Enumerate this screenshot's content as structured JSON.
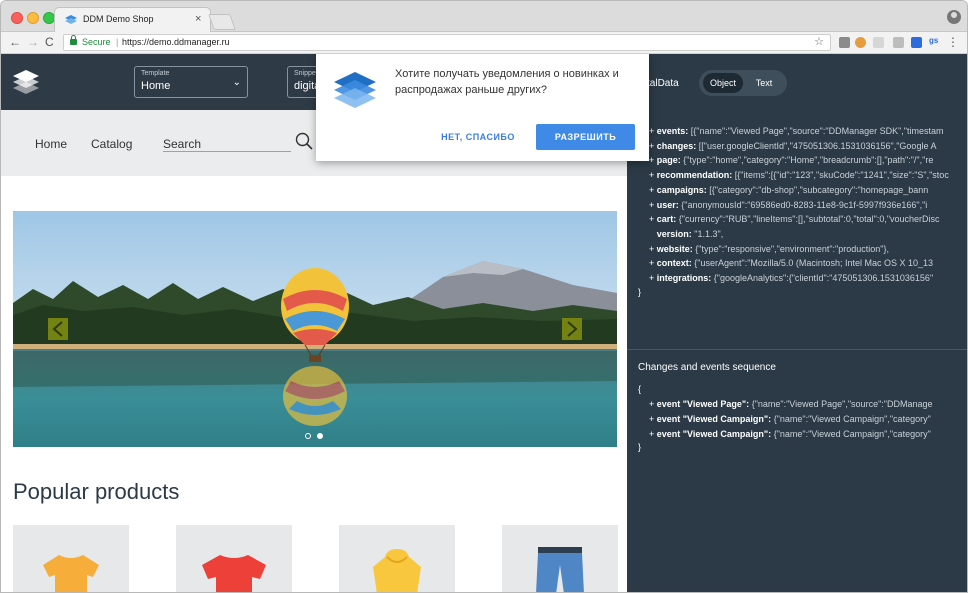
{
  "browser": {
    "tab_title": "DDM Demo Shop",
    "tab_close": "×",
    "secure_label": "Secure",
    "url_separator": "|",
    "url": "https://demo.ddmanager.ru",
    "ext_label": "gs",
    "back": "←",
    "forward": "→",
    "reload": "C",
    "star": "☆",
    "menu": "⋮"
  },
  "site": {
    "template_dropdown": {
      "label": "Template",
      "value": "Home"
    },
    "snippet_dropdown": {
      "label": "Snippet",
      "value": "digita"
    },
    "nav": {
      "home": "Home",
      "catalog": "Catalog",
      "search_placeholder": "Search"
    },
    "popular_title": "Popular products"
  },
  "notification": {
    "message": "Хотите получать уведомления о новинках и распродажах раньше других?",
    "deny_label": "НЕТ, СПАСИБО",
    "allow_label": "РАЗРЕШИТЬ"
  },
  "panel": {
    "title_partial": "igitalData",
    "view_options": {
      "object": "Object",
      "text": "Text"
    },
    "open_brace": "{",
    "close_brace": "}",
    "digital_data": [
      {
        "key": "events:",
        "value": "[{\"name\":\"Viewed Page\",\"source\":\"DDManager SDK\",\"timestam"
      },
      {
        "key": "changes:",
        "value": "[[\"user.googleClientId\",\"475051306.1531036156\",\"Google A"
      },
      {
        "key": "page:",
        "value": "{\"type\":\"home\",\"category\":\"Home\",\"breadcrumb\":[],\"path\":\"/\",\"re"
      },
      {
        "key": "recommendation:",
        "value": "[{\"items\":[{\"id\":\"123\",\"skuCode\":\"1241\",\"size\":\"S\",\"stoc"
      },
      {
        "key": "campaigns:",
        "value": "[{\"category\":\"db-shop\",\"subcategory\":\"homepage_bann"
      },
      {
        "key": "user:",
        "value": "{\"anonymousId\":\"69586ed0-8283-11e8-9c1f-5997f936e166\",\"i"
      },
      {
        "key": "cart:",
        "value": "{\"currency\":\"RUB\",\"lineItems\":[],\"subtotal\":0,\"total\":0,\"voucherDisc"
      },
      {
        "key": "version:",
        "value": "\"1.1.3\","
      },
      {
        "key": "website:",
        "value": "{\"type\":\"responsive\",\"environment\":\"production\"},"
      },
      {
        "key": "context:",
        "value": "{\"userAgent\":\"Mozilla/5.0 (Macintosh; Intel Mac OS X 10_13"
      },
      {
        "key": "integrations:",
        "value": "{\"googleAnalytics\":{\"clientId\":\"475051306.1531036156\""
      }
    ],
    "sequence_title": "Changes and events sequence",
    "sequence": [
      {
        "key": "event \"Viewed Page\":",
        "value": "{\"name\":\"Viewed Page\",\"source\":\"DDManage"
      },
      {
        "key": "event \"Viewed Campaign\":",
        "value": "{\"name\":\"Viewed Campaign\",\"category\""
      },
      {
        "key": "event \"Viewed Campaign\":",
        "value": "{\"name\":\"Viewed Campaign\",\"category\""
      }
    ]
  },
  "colors": {
    "header_bg": "#2e3b46",
    "panel_bg": "#2b3a46",
    "accent_blue": "#3e8ae6",
    "secure_green": "#1e8e3e"
  }
}
